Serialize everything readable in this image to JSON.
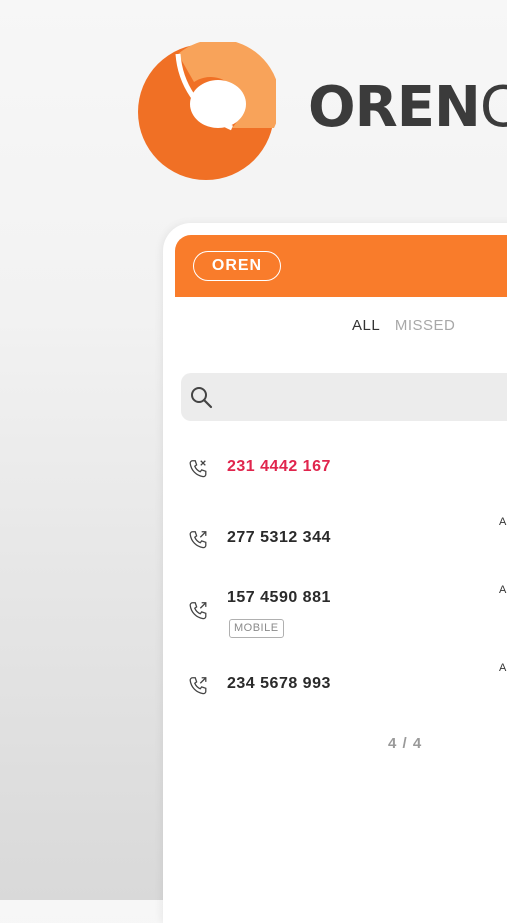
{
  "brand": {
    "name": "OREN",
    "name_tail": "C",
    "accent": "#f97c2b"
  },
  "header": {
    "org_label": "OREN"
  },
  "tabs": [
    {
      "label": "ALL",
      "active": true
    },
    {
      "label": "MISSED",
      "active": false
    }
  ],
  "search": {
    "placeholder": "",
    "icon": "search-icon"
  },
  "calls": [
    {
      "number": "231 4442 167",
      "type": "missed",
      "icon": "missed-call-icon",
      "meta": "",
      "badge": ""
    },
    {
      "number": "277 5312 344",
      "type": "outgoing",
      "icon": "outgoing-call-icon",
      "meta": "A",
      "badge": ""
    },
    {
      "number": "157 4590 881",
      "type": "outgoing",
      "icon": "outgoing-call-icon",
      "meta": "A",
      "badge": "MOBILE"
    },
    {
      "number": "234 5678 993",
      "type": "outgoing",
      "icon": "outgoing-call-icon",
      "meta": "A",
      "badge": ""
    }
  ],
  "pagination": {
    "label": "4 / 4"
  },
  "colors": {
    "missed": "#e0254d",
    "header": "#f97c2b"
  }
}
